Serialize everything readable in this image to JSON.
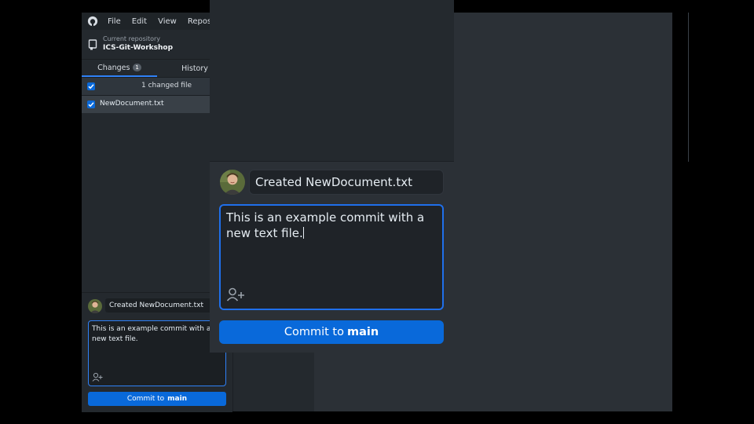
{
  "menu": [
    "File",
    "Edit",
    "View",
    "Reposito"
  ],
  "repository": {
    "label": "Current repository",
    "name": "ICS-Git-Workshop"
  },
  "tabs": {
    "changes": "Changes",
    "changes_count": "1",
    "history": "History"
  },
  "changes": {
    "summary": "1 changed file",
    "files": [
      "NewDocument.txt"
    ]
  },
  "commit": {
    "summary": "Created NewDocument.txt",
    "description": "This is an example commit with a new text file.",
    "button_prefix": "Commit to",
    "branch": "main"
  },
  "colors": {
    "accent": "#0969da",
    "focus_border": "#1f6feb",
    "background": "#24292e"
  },
  "icons": [
    "github-logo-icon",
    "repository-icon",
    "checkbox-checked-icon",
    "add-coauthor-icon",
    "avatar"
  ]
}
